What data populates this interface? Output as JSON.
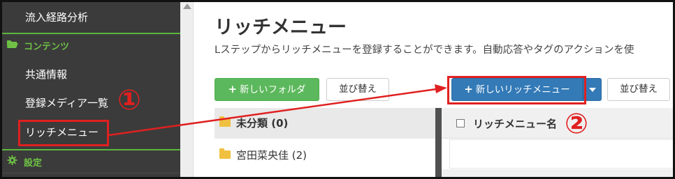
{
  "sidebar": {
    "items": [
      {
        "label": "流入経路分析"
      },
      {
        "label": "共通情報"
      },
      {
        "label": "登録メディア一覧"
      },
      {
        "label": "リッチメニュー"
      }
    ],
    "sections": [
      {
        "label": "コンテンツ",
        "icon": "folder-open-icon"
      },
      {
        "label": "設定",
        "icon": "gear-icon"
      }
    ]
  },
  "page": {
    "title": "リッチメニュー",
    "description": "Lステップからリッチメニューを登録することができます。自動応答やタグのアクションを使"
  },
  "toolbar": {
    "new_folder_label": "新しいフォルダ",
    "sort_label_1": "並び替え",
    "new_richmenu_label": "新しいリッチメニュー",
    "sort_label_2": "並び替え"
  },
  "folders": [
    {
      "label": "未分類 (0)",
      "selected": true
    },
    {
      "label": "宮田菜央佳 (2)",
      "selected": false
    }
  ],
  "table": {
    "header": "リッチメニュー名"
  },
  "annotations": {
    "step1": "①",
    "step2": "②"
  },
  "colors": {
    "sidebar_bg": "#3b3b3b",
    "accent_green": "#5cb85c",
    "primary_blue": "#337ab7",
    "annotation_red": "#e02020"
  }
}
